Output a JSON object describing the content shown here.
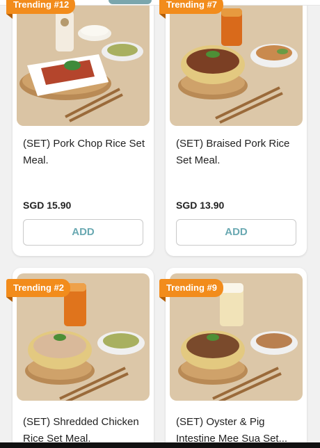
{
  "colors": {
    "badge": "#f28c1c",
    "add_button_text": "#6aa9b2",
    "price_text": "#222222"
  },
  "products": [
    {
      "badge": "Trending #12",
      "title": "(SET) Pork Chop Rice Set Meal.",
      "price": "SGD 15.90",
      "add_label": "ADD",
      "image": "pork-chop-rice-set-photo"
    },
    {
      "badge": "Trending #7",
      "title": "(SET) Braised Pork Rice Set Meal.",
      "price": "SGD 13.90",
      "add_label": "ADD",
      "image": "braised-pork-rice-set-photo"
    },
    {
      "badge": "Trending #2",
      "title": "(SET) Shredded Chicken Rice Set Meal.",
      "price": "",
      "add_label": "",
      "image": "shredded-chicken-rice-set-photo"
    },
    {
      "badge": "Trending #9",
      "title": "(SET) Oyster & Pig Intestine Mee Sua Set...",
      "price": "",
      "add_label": "",
      "image": "oyster-mee-sua-set-photo"
    }
  ]
}
